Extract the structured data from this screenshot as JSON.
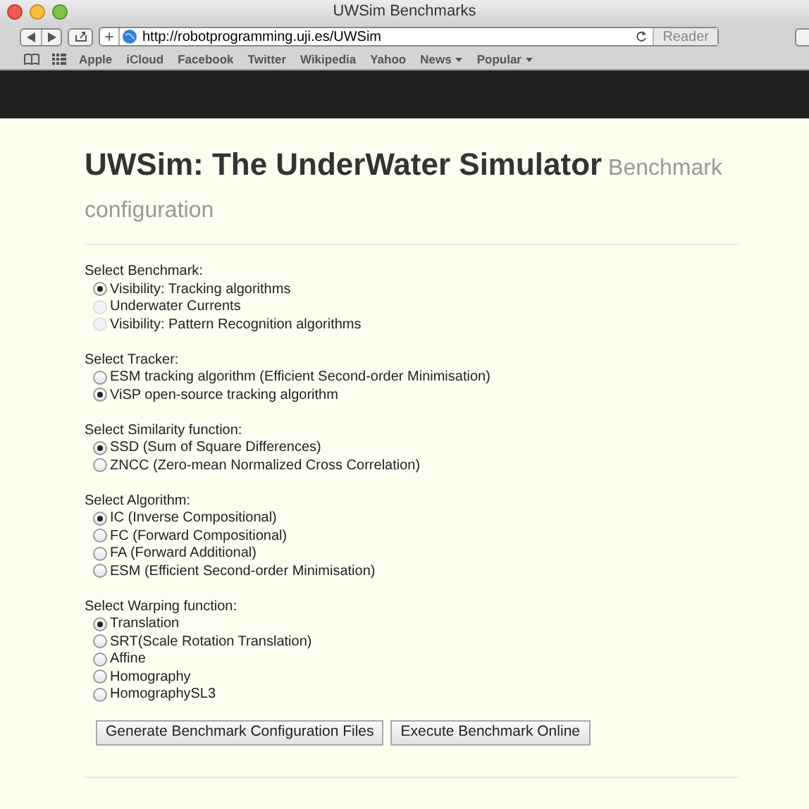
{
  "window": {
    "title": "UWSim Benchmarks"
  },
  "toolbar": {
    "add": "+",
    "url": "http://robotprogramming.uji.es/UWSim",
    "reader": "Reader"
  },
  "bookmarks": [
    {
      "label": "Apple",
      "menu": false
    },
    {
      "label": "iCloud",
      "menu": false
    },
    {
      "label": "Facebook",
      "menu": false
    },
    {
      "label": "Twitter",
      "menu": false
    },
    {
      "label": "Wikipedia",
      "menu": false
    },
    {
      "label": "Yahoo",
      "menu": false
    },
    {
      "label": "News",
      "menu": true
    },
    {
      "label": "Popular",
      "menu": true
    }
  ],
  "page": {
    "title": "UWSim: The UnderWater Simulator",
    "subtitle": "Benchmark configuration",
    "groups": [
      {
        "label": "Select Benchmark:",
        "options": [
          {
            "label": "Visibility: Tracking algorithms",
            "selected": true,
            "disabled": false
          },
          {
            "label": "Underwater Currents",
            "selected": false,
            "disabled": true
          },
          {
            "label": "Visibility: Pattern Recognition algorithms",
            "selected": false,
            "disabled": true
          }
        ]
      },
      {
        "label": "Select Tracker:",
        "options": [
          {
            "label": "ESM tracking algorithm (Efficient Second-order Minimisation)",
            "selected": false,
            "disabled": false
          },
          {
            "label": "ViSP open-source tracking algorithm",
            "selected": true,
            "disabled": false
          }
        ]
      },
      {
        "label": "Select Similarity function:",
        "options": [
          {
            "label": "SSD (Sum of Square Differences)",
            "selected": true,
            "disabled": false
          },
          {
            "label": "ZNCC (Zero-mean Normalized Cross Correlation)",
            "selected": false,
            "disabled": false
          }
        ]
      },
      {
        "label": "Select Algorithm:",
        "options": [
          {
            "label": "IC (Inverse Compositional)",
            "selected": true,
            "disabled": false
          },
          {
            "label": "FC (Forward Compositional)",
            "selected": false,
            "disabled": false
          },
          {
            "label": "FA (Forward Additional)",
            "selected": false,
            "disabled": false
          },
          {
            "label": "ESM (Efficient Second-order Minimisation)",
            "selected": false,
            "disabled": false
          }
        ]
      },
      {
        "label": "Select Warping function:",
        "options": [
          {
            "label": "Translation",
            "selected": true,
            "disabled": false
          },
          {
            "label": "SRT(Scale Rotation Translation)",
            "selected": false,
            "disabled": false
          },
          {
            "label": "Affine",
            "selected": false,
            "disabled": false
          },
          {
            "label": "Homography",
            "selected": false,
            "disabled": false
          },
          {
            "label": "HomographySL3",
            "selected": false,
            "disabled": false
          }
        ]
      }
    ],
    "buttons": [
      "Generate Benchmark Configuration Files",
      "Execute Benchmark Online"
    ]
  }
}
